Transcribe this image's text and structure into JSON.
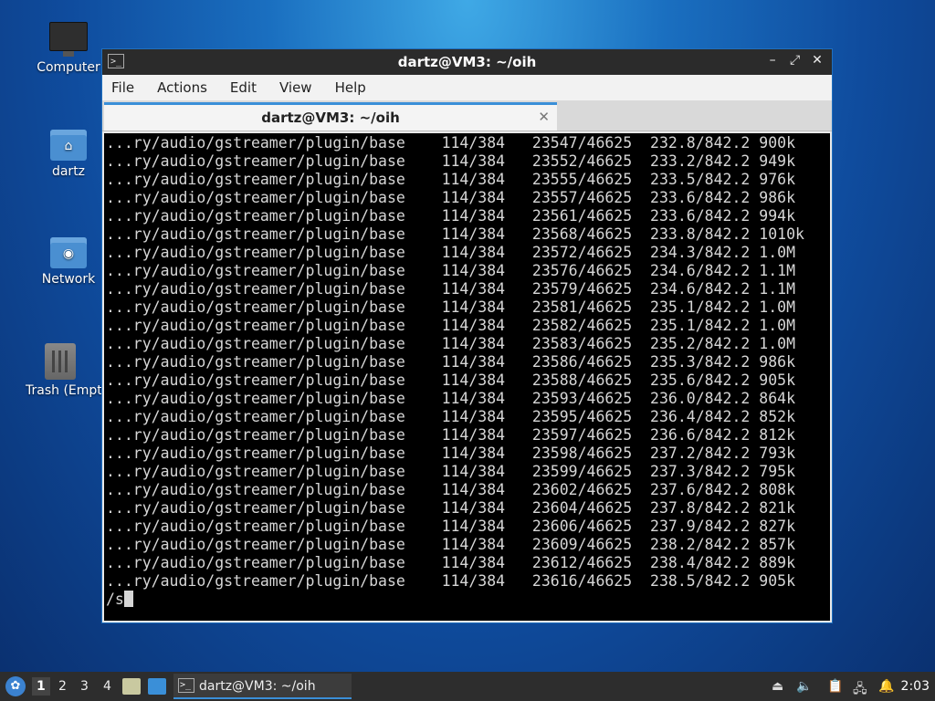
{
  "desktop": {
    "icons": [
      {
        "label": "Computer"
      },
      {
        "label": "dartz"
      },
      {
        "label": "Network"
      },
      {
        "label": "Trash (Empty)"
      }
    ]
  },
  "window": {
    "title": "dartz@VM3: ~/oih",
    "menu": [
      "File",
      "Actions",
      "Edit",
      "View",
      "Help"
    ],
    "tab_label": "dartz@VM3: ~/oih",
    "tab_close": "✕",
    "controls": {
      "minimize": "–",
      "maximize": "⤢",
      "close": "✕"
    }
  },
  "terminal": {
    "rows": [
      {
        "path": "...ry/audio/gstreamer/plugin/base",
        "pkgs": "114/384",
        "files": "23547/46625",
        "mb": "232.8/842.2",
        "rate": "900k"
      },
      {
        "path": "...ry/audio/gstreamer/plugin/base",
        "pkgs": "114/384",
        "files": "23552/46625",
        "mb": "233.2/842.2",
        "rate": "949k"
      },
      {
        "path": "...ry/audio/gstreamer/plugin/base",
        "pkgs": "114/384",
        "files": "23555/46625",
        "mb": "233.5/842.2",
        "rate": "976k"
      },
      {
        "path": "...ry/audio/gstreamer/plugin/base",
        "pkgs": "114/384",
        "files": "23557/46625",
        "mb": "233.6/842.2",
        "rate": "986k"
      },
      {
        "path": "...ry/audio/gstreamer/plugin/base",
        "pkgs": "114/384",
        "files": "23561/46625",
        "mb": "233.6/842.2",
        "rate": "994k"
      },
      {
        "path": "...ry/audio/gstreamer/plugin/base",
        "pkgs": "114/384",
        "files": "23568/46625",
        "mb": "233.8/842.2",
        "rate": "1010k"
      },
      {
        "path": "...ry/audio/gstreamer/plugin/base",
        "pkgs": "114/384",
        "files": "23572/46625",
        "mb": "234.3/842.2",
        "rate": "1.0M"
      },
      {
        "path": "...ry/audio/gstreamer/plugin/base",
        "pkgs": "114/384",
        "files": "23576/46625",
        "mb": "234.6/842.2",
        "rate": "1.1M"
      },
      {
        "path": "...ry/audio/gstreamer/plugin/base",
        "pkgs": "114/384",
        "files": "23579/46625",
        "mb": "234.6/842.2",
        "rate": "1.1M"
      },
      {
        "path": "...ry/audio/gstreamer/plugin/base",
        "pkgs": "114/384",
        "files": "23581/46625",
        "mb": "235.1/842.2",
        "rate": "1.0M"
      },
      {
        "path": "...ry/audio/gstreamer/plugin/base",
        "pkgs": "114/384",
        "files": "23582/46625",
        "mb": "235.1/842.2",
        "rate": "1.0M"
      },
      {
        "path": "...ry/audio/gstreamer/plugin/base",
        "pkgs": "114/384",
        "files": "23583/46625",
        "mb": "235.2/842.2",
        "rate": "1.0M"
      },
      {
        "path": "...ry/audio/gstreamer/plugin/base",
        "pkgs": "114/384",
        "files": "23586/46625",
        "mb": "235.3/842.2",
        "rate": "986k"
      },
      {
        "path": "...ry/audio/gstreamer/plugin/base",
        "pkgs": "114/384",
        "files": "23588/46625",
        "mb": "235.6/842.2",
        "rate": "905k"
      },
      {
        "path": "...ry/audio/gstreamer/plugin/base",
        "pkgs": "114/384",
        "files": "23593/46625",
        "mb": "236.0/842.2",
        "rate": "864k"
      },
      {
        "path": "...ry/audio/gstreamer/plugin/base",
        "pkgs": "114/384",
        "files": "23595/46625",
        "mb": "236.4/842.2",
        "rate": "852k"
      },
      {
        "path": "...ry/audio/gstreamer/plugin/base",
        "pkgs": "114/384",
        "files": "23597/46625",
        "mb": "236.6/842.2",
        "rate": "812k"
      },
      {
        "path": "...ry/audio/gstreamer/plugin/base",
        "pkgs": "114/384",
        "files": "23598/46625",
        "mb": "237.2/842.2",
        "rate": "793k"
      },
      {
        "path": "...ry/audio/gstreamer/plugin/base",
        "pkgs": "114/384",
        "files": "23599/46625",
        "mb": "237.3/842.2",
        "rate": "795k"
      },
      {
        "path": "...ry/audio/gstreamer/plugin/base",
        "pkgs": "114/384",
        "files": "23602/46625",
        "mb": "237.6/842.2",
        "rate": "808k"
      },
      {
        "path": "...ry/audio/gstreamer/plugin/base",
        "pkgs": "114/384",
        "files": "23604/46625",
        "mb": "237.8/842.2",
        "rate": "821k"
      },
      {
        "path": "...ry/audio/gstreamer/plugin/base",
        "pkgs": "114/384",
        "files": "23606/46625",
        "mb": "237.9/842.2",
        "rate": "827k"
      },
      {
        "path": "...ry/audio/gstreamer/plugin/base",
        "pkgs": "114/384",
        "files": "23609/46625",
        "mb": "238.2/842.2",
        "rate": "857k"
      },
      {
        "path": "...ry/audio/gstreamer/plugin/base",
        "pkgs": "114/384",
        "files": "23612/46625",
        "mb": "238.4/842.2",
        "rate": "889k"
      },
      {
        "path": "...ry/audio/gstreamer/plugin/base",
        "pkgs": "114/384",
        "files": "23616/46625",
        "mb": "238.5/842.2",
        "rate": "905k"
      }
    ],
    "prompt_input": "/s"
  },
  "taskbar": {
    "workspaces": [
      "1",
      "2",
      "3",
      "4"
    ],
    "active_workspace": "1",
    "task_label": "dartz@VM3: ~/oih",
    "clock": "2:03",
    "colors": {
      "accent": "#3a8fd8",
      "panel": "#2d2d2d"
    }
  }
}
